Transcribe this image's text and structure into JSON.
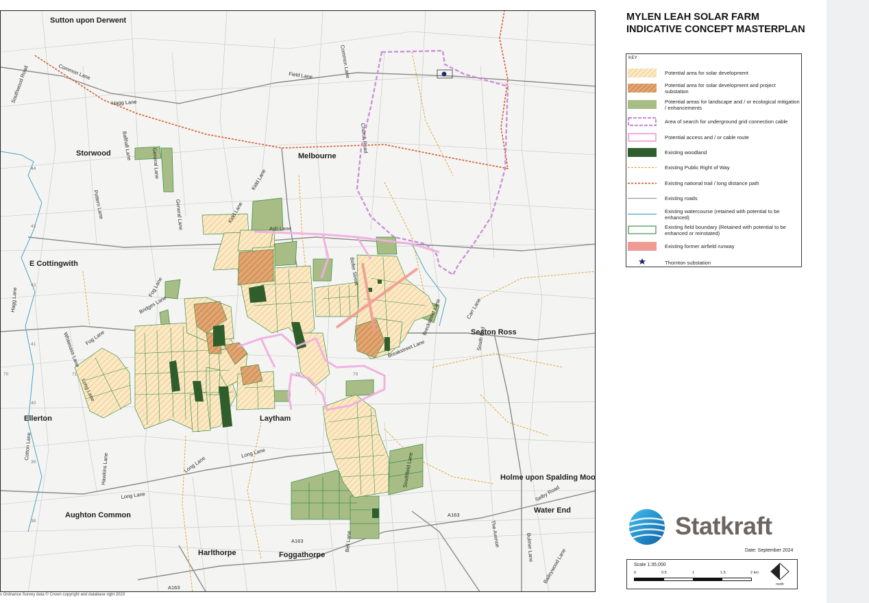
{
  "title": {
    "line1": "MYLEN LEAH SOLAR FARM",
    "line2": "INDICATIVE CONCEPT MASTERPLAN"
  },
  "key": {
    "heading": "KEY",
    "items": [
      {
        "symbol": "hatch-yellow",
        "label": "Potential area for solar development"
      },
      {
        "symbol": "hatch-orange",
        "label": "Potential area for solar development and project substation"
      },
      {
        "symbol": "fill-green",
        "label": "Potential areas for landscape and / or ecological mitigation / enhancements"
      },
      {
        "symbol": "dash-purple",
        "label": "Area of search for underground grid connection cable"
      },
      {
        "symbol": "outline-pink",
        "label": "Potential access and / or cable route"
      },
      {
        "symbol": "fill-darkgreen",
        "label": "Existing woodland"
      },
      {
        "symbol": "dash-yellow",
        "label": "Existing Public Right of Way"
      },
      {
        "symbol": "dash-red",
        "label": "Existing national trail / long distance path"
      },
      {
        "symbol": "line-grey",
        "label": "Existing roads"
      },
      {
        "symbol": "line-blue",
        "label": "Existing  watercourse (retained with potential to be enhanced)"
      },
      {
        "symbol": "outline-green",
        "label": "Existing field boundary (Retained with potential to be enhanced or reinstated)"
      },
      {
        "symbol": "fill-salmon",
        "label": "Existing former airfield runway"
      },
      {
        "symbol": "star-navy",
        "label": "Thornton substation"
      }
    ]
  },
  "map": {
    "places": [
      "Sutton upon Derwent",
      "Storwood",
      "Melbourne",
      "E Cottingwith",
      "Seaton Ross",
      "Ellerton",
      "Laytham",
      "Holme upon Spalding Moor",
      "Aughton Common",
      "Water End",
      "Harlthorpe",
      "Foggathorpe"
    ],
    "roads": [
      "Southwood Road",
      "Common Lane",
      "Hagg Lane",
      "Field Lane",
      "Common Lane",
      "Church Road",
      "Ballhall Lane",
      "General Lane",
      "Kidd Lane",
      "Kidd Lane",
      "General Lane",
      "Ash Lane",
      "Pottern Lane",
      "Fog Lane",
      "Bridges Lane",
      "Hagg Lane",
      "Whitesass Lane",
      "Fog Lane",
      "Long Lane",
      "Breakstreet Lane",
      "Breckstreet Lane",
      "Carr Lane",
      "South End",
      "Cotton Lane",
      "Hawkins Lane",
      "Long Lane",
      "Long Lane",
      "Long Lane",
      "Southfield Lane",
      "A163",
      "A163",
      "A163",
      "Bell Lane",
      "The Avenue",
      "Bulmer Lane",
      "Selby Road",
      "Baileywood Lane",
      "Boller Street"
    ],
    "grid_numbers": [
      "44",
      "43",
      "42",
      "41",
      "40",
      "39",
      "38",
      "70",
      "71",
      "75",
      "79"
    ],
    "copyright": "s Ordnance Survey data © Crown copyright and database right 2023"
  },
  "brand": {
    "name": "Statkraft"
  },
  "date": {
    "label": "Date:  September 2024"
  },
  "scale": {
    "label": "Scale 1:35,000",
    "ticks": [
      "0",
      "0.5",
      "1",
      "1.5",
      "2 km"
    ]
  },
  "north_label": "north",
  "colors": {
    "solar_fill": "#fbe9c5",
    "solar_hatch": "#e2b56d",
    "substation_fill": "#e2a56f",
    "substation_hatch": "#a86a3a",
    "mitigation": "#a7bd85",
    "woodland": "#2f5e2c",
    "grid_search": "#c98ad6",
    "access": "#f0aee0",
    "prow": "#e6a43a",
    "trail": "#d15a2f",
    "roads": "#9a9a9a",
    "water": "#4aa3c4",
    "field_boundary": "#3f8f4a",
    "runway": "#ef9b93",
    "substation_star": "#1c2a6e",
    "brand_blue": "#1a86c8",
    "brand_text": "#6d6560"
  }
}
